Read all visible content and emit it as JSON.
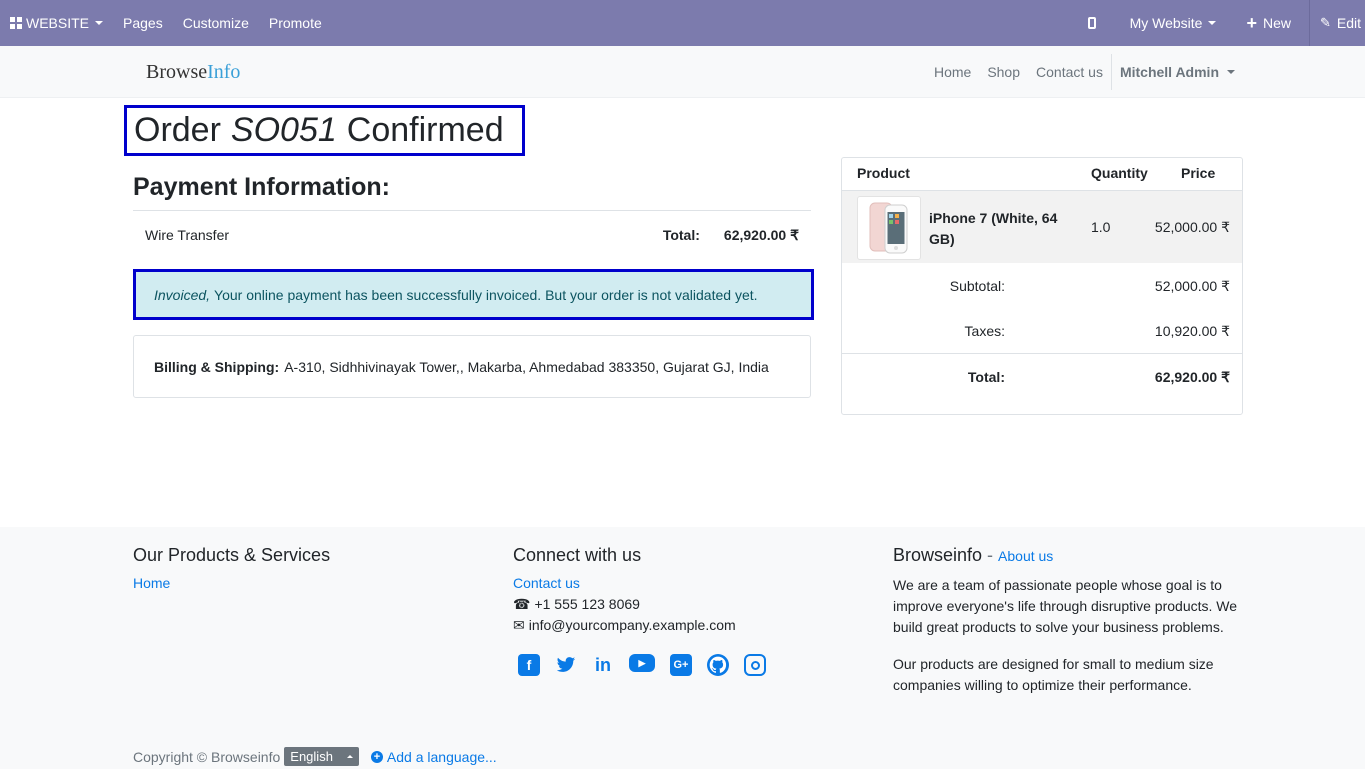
{
  "admin_bar": {
    "website_label": "WEBSITE",
    "pages_label": "Pages",
    "customize_label": "Customize",
    "promote_label": "Promote",
    "my_website_label": "My Website",
    "new_label": "New",
    "edit_label": "Edit",
    "bg_color": "#7c7bad"
  },
  "navbar": {
    "brand_part1": "Browse",
    "brand_part2": "Info",
    "links": [
      "Home",
      "Shop",
      "Contact us"
    ],
    "user": "Mitchell Admin"
  },
  "order": {
    "title_prefix": "Order",
    "order_ref": "SO051",
    "title_suffix": "Confirmed"
  },
  "payment": {
    "heading": "Payment Information:",
    "method": "Wire Transfer",
    "total_label": "Total:",
    "total_value": "62,920.00 ₹"
  },
  "alert": {
    "status": "Invoiced,",
    "message": "Your online payment has been successfully invoiced. But your order is not validated yet.",
    "bg_color": "#d1ecf1"
  },
  "billing": {
    "label": "Billing & Shipping:",
    "address": "A-310, Sidhhivinayak Tower,, Makarba, Ahmedabad 383350, Gujarat GJ, India"
  },
  "summary": {
    "headers": {
      "product": "Product",
      "quantity": "Quantity",
      "price": "Price"
    },
    "item": {
      "name": "iPhone 7 (White, 64 GB)",
      "quantity": "1.0",
      "price": "52,000.00 ₹"
    },
    "subtotal_label": "Subtotal:",
    "subtotal_value": "52,000.00 ₹",
    "taxes_label": "Taxes:",
    "taxes_value": "10,920.00 ₹",
    "total_label": "Total:",
    "total_value": "62,920.00 ₹"
  },
  "footer": {
    "col1_heading": "Our Products & Services",
    "col1_link": "Home",
    "col2_heading": "Connect with us",
    "contact_link": "Contact us",
    "phone": "+1 555 123 8069",
    "email": "info@yourcompany.example.com",
    "col3_heading": "Browseinfo",
    "col3_dash": " - ",
    "about_link": "About us",
    "para1": "We are a team of passionate people whose goal is to improve everyone's life through disruptive products. We build great products to solve your business problems.",
    "para2": "Our products are designed for small to medium size companies willing to optimize their performance.",
    "copyright": "Copyright © Browseinfo",
    "language": "English",
    "add_language": "Add a language...",
    "accent_color": "#0a7ae6"
  }
}
